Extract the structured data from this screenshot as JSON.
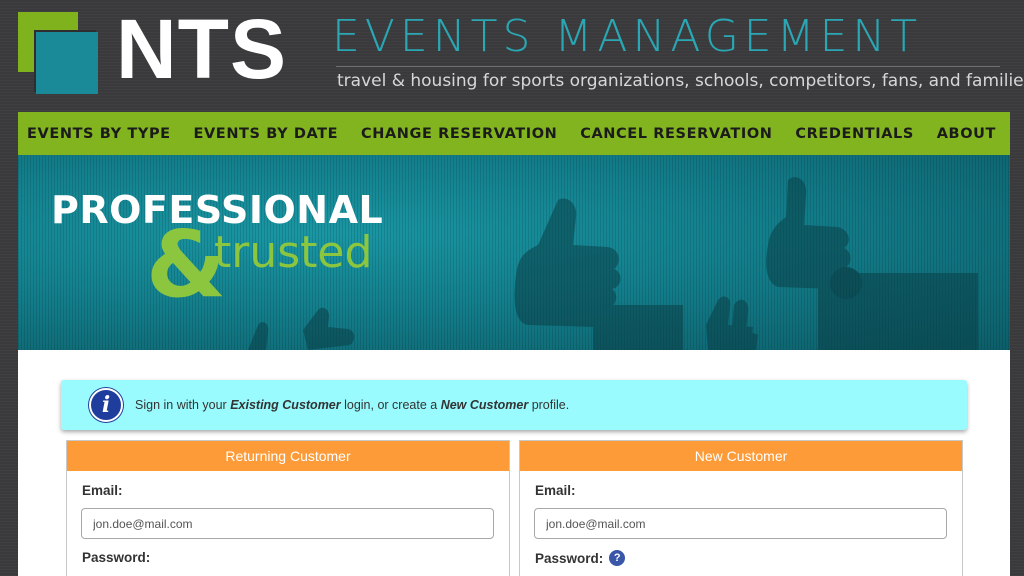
{
  "brand": {
    "nts": "NTS",
    "title": "EVENTS MANAGEMENT",
    "tagline": "travel & housing for sports organizations, schools, competitors, fans, and families"
  },
  "nav": {
    "items": [
      {
        "label": "EVENTS BY TYPE"
      },
      {
        "label": "EVENTS BY DATE"
      },
      {
        "label": "CHANGE RESERVATION"
      },
      {
        "label": "CANCEL RESERVATION"
      },
      {
        "label": "CREDENTIALS"
      },
      {
        "label": "ABOUT"
      }
    ]
  },
  "hero": {
    "line1": "PROFESSIONAL",
    "amp": "&",
    "line2": "trusted"
  },
  "info": {
    "prefix": "Sign in with your ",
    "existing": "Existing Customer",
    "middle": " login, or create a ",
    "new": "New Customer",
    "suffix": " profile."
  },
  "returning": {
    "title": "Returning Customer",
    "email_label": "Email:",
    "email_placeholder": "jon.doe@mail.com",
    "password_label": "Password:"
  },
  "new_customer": {
    "title": "New Customer",
    "email_label": "Email:",
    "email_placeholder": "jon.doe@mail.com",
    "password_label": "Password:"
  },
  "colors": {
    "nav_green": "#82b41f",
    "brand_teal": "#2aa7b4",
    "panel_orange": "#fc9b38",
    "info_cyan": "#99fbfd"
  },
  "icons": {
    "info": "info-icon",
    "help": "question-icon"
  }
}
